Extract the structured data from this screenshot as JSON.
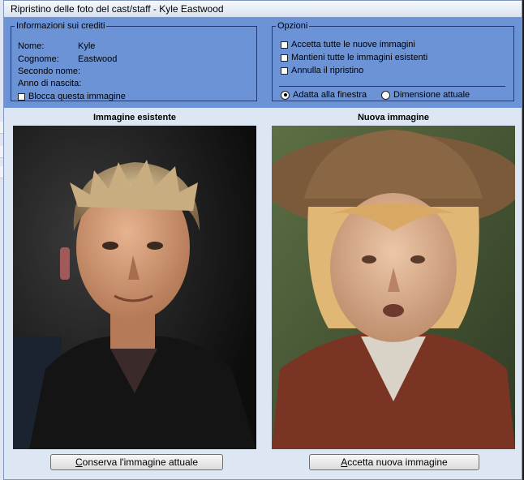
{
  "dialog": {
    "title": "Ripristino delle foto del cast/staff - Kyle Eastwood"
  },
  "credits": {
    "legend": "Informazioni sui crediti",
    "fields": [
      {
        "label": "Nome:",
        "value": "Kyle"
      },
      {
        "label": "Cognome:",
        "value": "Eastwood"
      },
      {
        "label": "Secondo nome:",
        "value": ""
      },
      {
        "label": "Anno di nascita:",
        "value": ""
      }
    ],
    "lock_label": "Blocca questa immagine",
    "lock_checked": false
  },
  "options": {
    "legend": "Opzioni",
    "checks": [
      {
        "label": "Accetta tutte le nuove immagini",
        "checked": false
      },
      {
        "label": "Mantieni tutte le immagini esistenti",
        "checked": false
      },
      {
        "label": "Annulla il ripristino",
        "checked": false
      }
    ],
    "radios": [
      {
        "label": "Adatta alla finestra",
        "selected": true
      },
      {
        "label": "Dimensione attuale",
        "selected": false
      }
    ]
  },
  "images": {
    "existing_heading": "Immagine esistente",
    "new_heading": "Nuova immagine"
  },
  "buttons": {
    "keep_first": "C",
    "keep_rest": "onserva l'immagine attuale",
    "accept_first": "A",
    "accept_rest": "ccetta nuova immagine"
  },
  "colors": {
    "panel_blue": "#6b93d6",
    "dialog_bg": "#dde6f3"
  }
}
